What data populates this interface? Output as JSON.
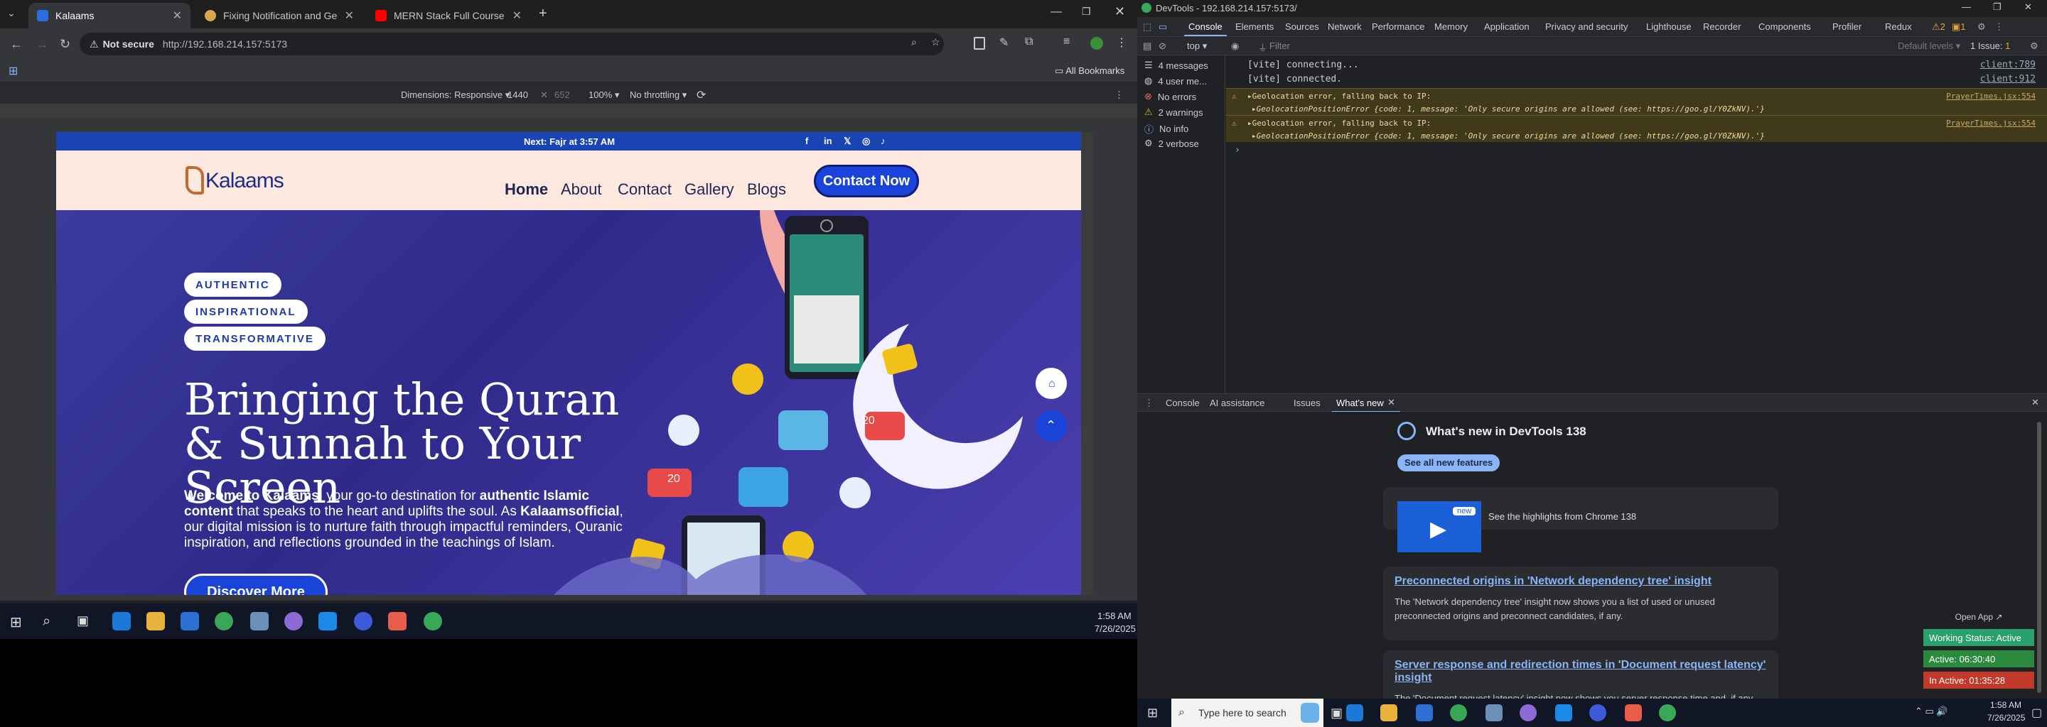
{
  "browser": {
    "tabs": [
      {
        "title": "Kalaams",
        "active": true,
        "color": "#2b6de0"
      },
      {
        "title": "Fixing Notification and Geoloca",
        "active": false,
        "color": "#d9a64e"
      },
      {
        "title": "MERN Stack Full Course - ECom",
        "active": false,
        "color": "#ff0000"
      }
    ],
    "security_label": "Not secure",
    "url": "http://192.168.214.157:5173",
    "all_bookmarks": "All Bookmarks",
    "device_toolbar": {
      "dimensions": "Dimensions: Responsive",
      "width": "1440",
      "height": "652",
      "zoom": "100%",
      "throttle": "No throttling"
    }
  },
  "site": {
    "topbar_text": "Next: Fajr at 3:57 AM",
    "logo": "Kalaams",
    "nav": [
      "Home",
      "About",
      "Contact",
      "Gallery",
      "Blogs"
    ],
    "cta": "Contact Now",
    "pills": [
      "AUTHENTIC",
      "INSPIRATIONAL",
      "TRANSFORMATIVE"
    ],
    "hero_title": "Bringing the Quran & Sunnah to Your Screen",
    "hero_text_parts": {
      "b1": "Welcome to Kalaams",
      "t1": ", your go-to destination for ",
      "b2": "authentic Islamic content",
      "t2": " that speaks to the heart and uplifts the soul. As ",
      "b3": "Kalaamsofficial",
      "t3": ", our digital mission is to nurture faith through impactful reminders, Quranic inspiration, and reflections grounded in the teachings of Islam."
    },
    "discover_button": "Discover More",
    "badge_like": "20",
    "badge_heart": "20"
  },
  "taskbar_left": {
    "time": "1:58 AM",
    "date": "7/26/2025"
  },
  "devtools": {
    "window_title": "DevTools - 192.168.214.157:5173/",
    "tabs": [
      "Console",
      "Elements",
      "Sources",
      "Network",
      "Performance",
      "Memory",
      "Application",
      "Privacy and security",
      "Lighthouse",
      "Recorder",
      "Components",
      "Profiler",
      "Redux"
    ],
    "warnings_count": "2",
    "issues_count": "1",
    "issue_label": "1 Issue:",
    "issue_count_badge": "1",
    "context": "top",
    "filter_placeholder": "Filter",
    "levels": "Default levels",
    "sidebar": [
      {
        "label": "4 messages",
        "icon": "list-icon"
      },
      {
        "label": "4 user me...",
        "icon": "user-icon"
      },
      {
        "label": "No errors",
        "icon": "error-icon"
      },
      {
        "label": "2 warnings",
        "icon": "warning-icon"
      },
      {
        "label": "No info",
        "icon": "info-icon"
      },
      {
        "label": "2 verbose",
        "icon": "verbose-icon"
      }
    ],
    "console_lines": [
      {
        "text": "[vite] connecting...",
        "src": "client:789",
        "type": "log"
      },
      {
        "text": "[vite] connected.",
        "src": "client:912",
        "type": "log"
      },
      {
        "text": "▸Geolocation error, falling back to IP:",
        "sub": "▸GeolocationPositionError {code: 1, message: 'Only secure origins are allowed (see: https://goo.gl/Y0ZkNV).'}",
        "src": "PrayerTimes.jsx:554",
        "type": "warn"
      },
      {
        "text": "▸Geolocation error, falling back to IP:",
        "sub": "▸GeolocationPositionError {code: 1, message: 'Only secure origins are allowed (see: https://goo.gl/Y0ZkNV).'}",
        "src": "PrayerTimes.jsx:554",
        "type": "warn"
      }
    ],
    "drawer_tabs": [
      "Console",
      "AI assistance",
      "Issues",
      "What's new"
    ],
    "whats_new": {
      "title": "What's new in DevTools 138",
      "see_all": "See all new features",
      "video_caption": "See the highlights from Chrome 138",
      "new_badge": "new",
      "items": [
        {
          "title": "Preconnected origins in 'Network dependency tree' insight",
          "desc": "The 'Network dependency tree' insight now shows you a list of used or unused preconnected origins and preconnect candidates, if any."
        },
        {
          "title": "Server response and redirection times in 'Document request latency' insight",
          "desc": "The 'Document request latency' insight now shows you server response time and, if any,"
        }
      ]
    }
  },
  "overlay": {
    "open_app": "Open App",
    "working_status": "Working Status: Active",
    "active": "Active: 06:30:40",
    "inactive": "In Active: 01:35:28"
  },
  "taskbar_right": {
    "search_placeholder": "Type here to search",
    "time": "1:58 AM",
    "date": "7/26/2025"
  },
  "colors": {
    "accent_blue": "#1a44b3",
    "cta_blue": "#1a44d9",
    "warning_yellow": "#f4d9a0"
  }
}
